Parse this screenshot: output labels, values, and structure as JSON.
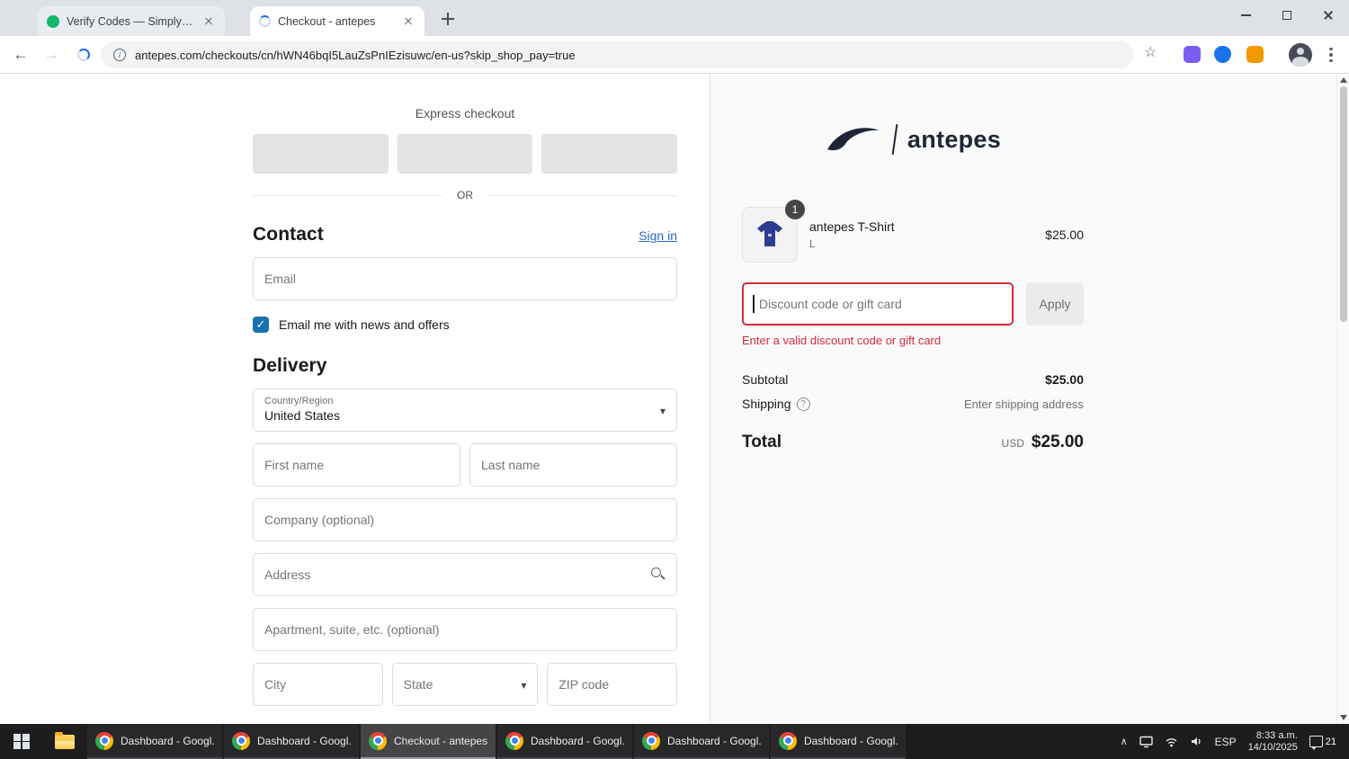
{
  "browser": {
    "tab1": {
      "title": "Verify Codes — SimplyCodes"
    },
    "tab2": {
      "title": "Checkout - antepes"
    },
    "url": "antepes.com/checkouts/cn/hWN46bqI5LauZsPnIEzisuwc/en-us?skip_shop_pay=true"
  },
  "checkout": {
    "express_label": "Express checkout",
    "or_label": "OR",
    "contact_title": "Contact",
    "sign_in": "Sign in",
    "email_placeholder": "Email",
    "newsletter_label": "Email me with news and offers",
    "delivery_title": "Delivery",
    "country_label": "Country/Region",
    "country_value": "United States",
    "first_name_placeholder": "First name",
    "last_name_placeholder": "Last name",
    "company_placeholder": "Company (optional)",
    "address_placeholder": "Address",
    "apartment_placeholder": "Apartment, suite, etc. (optional)",
    "city_placeholder": "City",
    "state_label": "State",
    "zip_placeholder": "ZIP code"
  },
  "summary": {
    "brand": "antepes",
    "item_qty": "1",
    "item_name": "antepes T-Shirt",
    "item_variant": "L",
    "item_price": "$25.00",
    "discount_placeholder": "Discount code or gift card",
    "apply_label": "Apply",
    "error_message": "Enter a valid discount code or gift card",
    "subtotal_label": "Subtotal",
    "subtotal_value": "$25.00",
    "shipping_label": "Shipping",
    "shipping_value": "Enter shipping address",
    "total_label": "Total",
    "currency": "USD",
    "total_value": "$25.00"
  },
  "taskbar": {
    "apps": [
      {
        "label": "Dashboard - Googl..."
      },
      {
        "label": "Dashboard - Googl..."
      },
      {
        "label": "Checkout - antepes..."
      },
      {
        "label": "Dashboard - Googl..."
      },
      {
        "label": "Dashboard - Googl..."
      },
      {
        "label": "Dashboard - Googl..."
      }
    ],
    "lang": "ESP",
    "time": "8:33 a.m.",
    "date": "14/10/2025",
    "notification_count": "21"
  },
  "colors": {
    "link_blue": "#2a66c9",
    "checkbox_blue": "#1773b0",
    "error_red": "#d22d3c",
    "brand_navy": "#1e2637",
    "summary_bg": "#fafafa"
  }
}
